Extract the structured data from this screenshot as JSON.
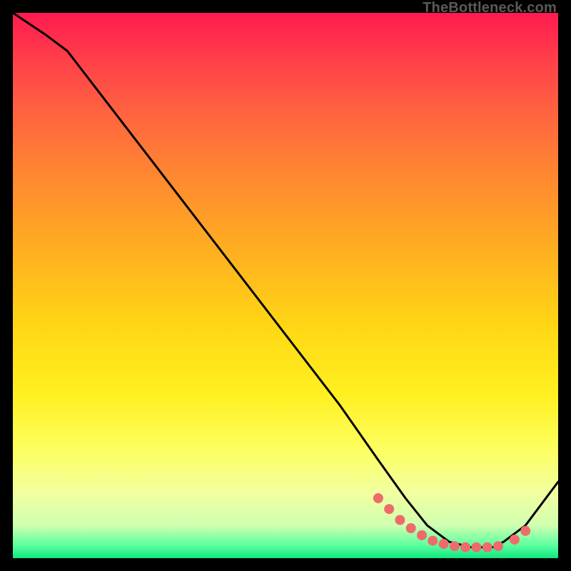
{
  "watermark": "TheBottleneck.com",
  "chart_data": {
    "type": "line",
    "title": "",
    "xlabel": "",
    "ylabel": "",
    "xlim": [
      0,
      100
    ],
    "ylim": [
      0,
      100
    ],
    "series": [
      {
        "name": "curve",
        "x": [
          0,
          6,
          10,
          20,
          30,
          40,
          50,
          60,
          67,
          72,
          76,
          80,
          84,
          88,
          90,
          94,
          100
        ],
        "y": [
          100,
          96,
          93,
          80,
          67,
          54,
          41,
          28,
          18,
          11,
          6,
          3,
          2,
          2,
          3,
          6,
          14
        ]
      }
    ],
    "highlight_dots": {
      "name": "dots",
      "x": [
        67,
        69,
        71,
        73,
        75,
        77,
        79,
        81,
        83,
        85,
        87,
        89,
        92,
        94
      ],
      "y": [
        11,
        9,
        7,
        5.5,
        4.2,
        3.2,
        2.6,
        2.2,
        2.0,
        2.0,
        2.0,
        2.2,
        3.4,
        5.0
      ]
    },
    "colors": {
      "line": "#000000",
      "dots": "#ef6b6b"
    }
  }
}
